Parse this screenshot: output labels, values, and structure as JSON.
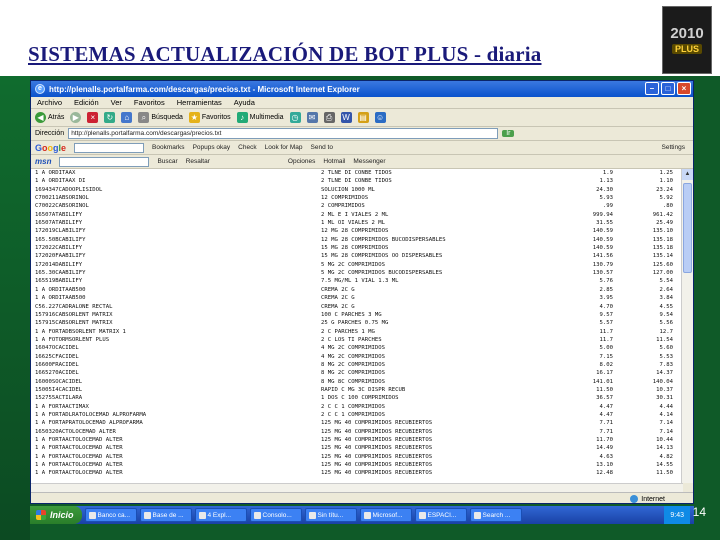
{
  "slide": {
    "title": "SISTEMAS ACTUALIZACIÓN DE BOT PLUS - diaria",
    "page_number": "14",
    "logo": {
      "year": "2010",
      "brand": "PLUS",
      "caption": ""
    }
  },
  "window": {
    "title": "http://plenalls.portalfarma.com/descargas/precios.txt - Microsoft Internet Explorer",
    "menu": [
      "Archivo",
      "Edición",
      "Ver",
      "Favoritos",
      "Herramientas",
      "Ayuda"
    ],
    "toolbar": {
      "back": "Atrás",
      "search": "Búsqueda",
      "favorites": "Favoritos",
      "multimedia": "Multimedia"
    },
    "address_label": "Dirección",
    "address_value": "http://plenalls.portalfarma.com/descargas/precios.txt",
    "go_label": "Ir",
    "google": {
      "label": "Google",
      "items": [
        "Bookmarks",
        "Popups okay",
        "Check",
        "Look for Map",
        "Send to",
        "Settings"
      ]
    },
    "msn": {
      "label": "msn",
      "items": [
        "Buscar",
        "Resaltar",
        "Opciones",
        "Hotmail",
        "Messenger"
      ]
    },
    "status": "Internet"
  },
  "rows": [
    [
      "1 A ORDITAAX",
      "2 TLNE DI CONBE TIDOS",
      "1.9",
      "1.25"
    ],
    [
      "1 A ORDITAAX DI",
      "2 TLNE DI CONBE TIDOS",
      "1.13",
      "1.10"
    ],
    [
      "1694347CADOOPLISIDOL",
      "SOLUCION 1000 ML",
      "24.30",
      "23.24"
    ],
    [
      "C700211ABSORINOL",
      "12 COMPRIMIDOS",
      "5.93",
      "5.92"
    ],
    [
      "C70022CABSORINOL",
      "2 COMPRIMIDOS",
      ".99",
      ".80"
    ],
    [
      "16507ATABILIFY",
      "2 ML E I VIALES 2 ML",
      "999.94",
      "961.42"
    ],
    [
      "16507ATABILIFY",
      "1 ML OI VIALES 2 ML",
      "31.55",
      "25.49"
    ],
    [
      "172019CLABILIFY",
      "12 MG 28 COMPRIMIDOS",
      "140.59",
      "135.10"
    ],
    [
      "165.50BCABILIFY",
      "12 MG 28 COMPRIMIDOS BUCODISPERSABLES",
      "140.59",
      "135.18"
    ],
    [
      "172022CABILIFY",
      "15 MG 28 COMPRIMIDOS",
      "140.59",
      "135.18"
    ],
    [
      "172020FAABILIFY",
      "15 MG 28 COMPRIMIDOS OO DISPERSABLES",
      "141.56",
      "135.14"
    ],
    [
      "172014DABILIFY",
      "5 MG 2C COMPRIMIDOS",
      "130.79",
      "125.60"
    ],
    [
      "165.30CAABILIFY",
      "5 MG 2C COMPRIMIDOS BUCODISPERSABLES",
      "130.57",
      "127.00"
    ],
    [
      "165519BABILIFY",
      "7.5 MG/ML 1 VIAL 1.3 ML",
      "5.76",
      "5.54"
    ],
    [
      "1 A ORDITAAB500",
      "CREMA 2C G",
      "2.85",
      "2.64"
    ],
    [
      "1 A ORDITAAB500",
      "CREMA 2C G",
      "3.95",
      "3.84"
    ],
    [
      "C56.227CADRALONE RECTAL",
      "CREMA 2C G",
      "4.70",
      "4.55"
    ],
    [
      "157916CABSORLENT MATRIX",
      "100 C PARCHES 3 MG",
      "9.57",
      "9.54"
    ],
    [
      "157915CABSORLENT MATRIX",
      "25 G PARCHES 0.75 MG",
      "5.57",
      "5.56"
    ],
    [
      "1 A FORTADBSORLENT MATRIX 1",
      "2 C PARCHES 1 MG",
      "11.7",
      "12.7"
    ],
    [
      "1 A FOTORMSORLENT PLUS",
      "2 C LOS TI PARCHES",
      "11.7",
      "11.54"
    ],
    [
      "16047OCACIDEL",
      "4 MG 2C COMPRIMIDOS",
      "5.00",
      "5.60"
    ],
    [
      "16625CFACIDEL",
      "4 MG 2C COMPRIMIDOS",
      "7.15",
      "5.53"
    ],
    [
      "16600FRACIDEL",
      "8 MG 2C COMPRIMIDOS",
      "8.02",
      "7.83"
    ],
    [
      "1665270ACIDEL",
      "8 MG 2C COMPRIMIDOS",
      "16.17",
      "14.37"
    ],
    [
      "16000SOCACIDEL",
      "8 MG 8C COMPRIMIDOS",
      "141.01",
      "140.04"
    ],
    [
      "15005I4CACIDEL",
      "RAPID C MG 3C DISPR RECUB",
      "11.50",
      "10.37"
    ],
    [
      "152755ACTILARA",
      "1 DOS C 100 COMPRIMIDOS",
      "36.57",
      "30.31"
    ],
    [
      "1 A FORTAACTIMAX",
      "2 C C 1 COMPRIMIDOS",
      "4.47",
      "4.44"
    ],
    [
      "1 A FORTADLRATOLOCEMAD ALPROFARMA",
      "2 C C 1 COMPRIMIDOS",
      "4.47",
      "4.14"
    ],
    [
      "1 A FORTAPRATOLOCEMAD ALPROFARMA",
      "125 MG 40 COMPRIMIDOS RECUBIERTOS",
      "7.71",
      "7.14"
    ],
    [
      "1650320ACTOLOCEMAD ALTER",
      "125 MG 40 COMPRIMIDOS RECUBIERTOS",
      "7.71",
      "7.14"
    ],
    [
      "1 A FORTAACTOLOCEMAD ALTER",
      "125 MG 40 COMPRIMIDOS RECUBIERTOS",
      "11.70",
      "10.44"
    ],
    [
      "1 A FORTAACTOLOCEMAD ALTER",
      "125 MG 40 COMPRIMIDOS RECUBIERTOS",
      "14.49",
      "14.13"
    ],
    [
      "1 A FORTAACTOLOCEMAD ALTER",
      "125 MG 40 COMPRIMIDOS RECUBIERTOS",
      "4.63",
      "4.82"
    ],
    [
      "1 A FORTAACTOLOCEMAD ALTER",
      "125 MG 40 COMPRIMIDOS RECUBIERTOS",
      "13.10",
      "14.55"
    ],
    [
      "1 A FORTAACTOLOCEMAD ALTER",
      "125 MG 40 COMPRIMIDOS RECUBIERTOS",
      "12.48",
      "11.50"
    ]
  ],
  "taskbar": {
    "start": "Inicio",
    "tasks": [
      "Banco ca...",
      "Base de ...",
      "4 Expl...",
      "Consolo...",
      "Sin títu...",
      "Microsof...",
      "ESPACI...",
      "Search ..."
    ],
    "clock": "9:43"
  },
  "colors": {
    "title": "#1a1a7a",
    "band": "#0f5a28",
    "taskbar": "#245edb"
  }
}
